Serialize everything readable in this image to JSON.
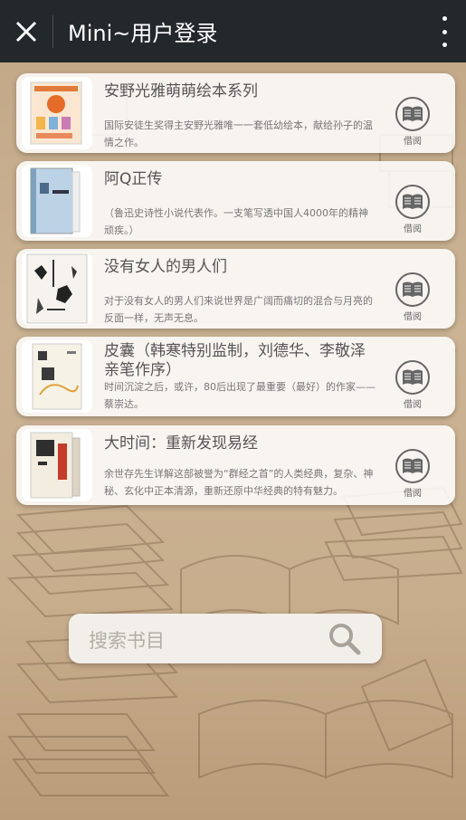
{
  "header": {
    "title": "Mini~用户登录"
  },
  "books": [
    {
      "title": "安野光雅萌萌绘本系列",
      "desc": "国际安徒生奖得主安野光雅唯一一套低幼绘本，献给孙子的温情之作。",
      "borrow_label": "借阅"
    },
    {
      "title": "阿Q正传",
      "desc": "（鲁迅史诗性小说代表作。一支笔写透中国人4000年的精神顽疾。）",
      "borrow_label": "借阅"
    },
    {
      "title": "没有女人的男人们",
      "desc": "对于没有女人的男人们来说世界是广阔而痛切的混合与月亮的反面一样，无声无息。",
      "borrow_label": "借阅"
    },
    {
      "title": "皮囊（韩寒特别监制，刘德华、李敬泽亲笔作序）",
      "desc": "时间沉淀之后，或许，80后出现了最重要（最好）的作家——蔡崇达。",
      "borrow_label": "借阅"
    },
    {
      "title": "大时间：重新发现易经",
      "desc": "余世存先生详解这部被誉为“群经之首”的人类经典，复杂、神秘、玄化中正本清源，重新还原中华经典的特有魅力。",
      "borrow_label": "借阅"
    }
  ],
  "search": {
    "placeholder": "搜索书目"
  },
  "icons": {
    "close": "close-icon",
    "more": "more-vertical-icon",
    "borrow": "book-icon",
    "search": "search-icon"
  },
  "colors": {
    "topbar": "#23282b",
    "background": "#c8ae8d",
    "card": "#ffffff",
    "text": "#555555"
  }
}
